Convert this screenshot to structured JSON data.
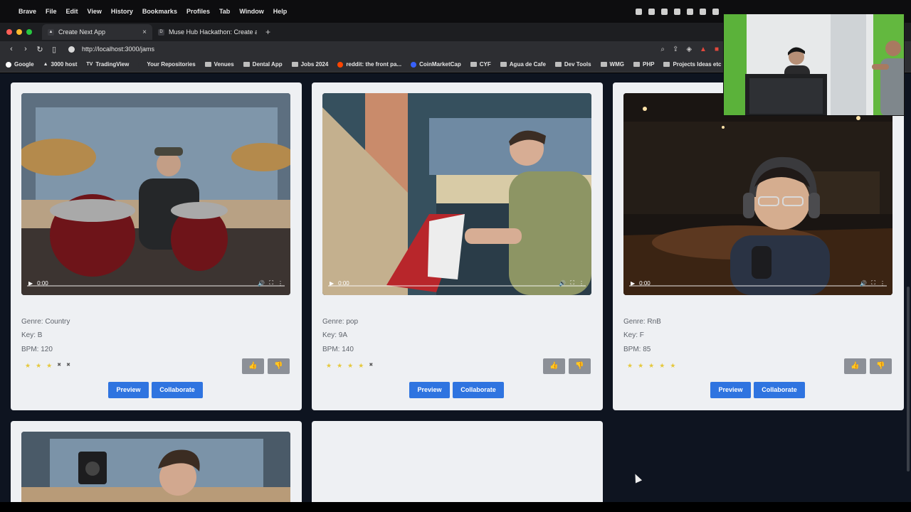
{
  "menubar": {
    "app": "Brave",
    "items": [
      "File",
      "Edit",
      "View",
      "History",
      "Bookmarks",
      "Profiles",
      "Tab",
      "Window",
      "Help"
    ]
  },
  "tabs": [
    {
      "title": "Create Next App",
      "favicon": "triangle-icon",
      "active": true
    },
    {
      "title": "Muse Hub Hackathon: Create an",
      "favicon": "D",
      "active": false
    }
  ],
  "url": "http://localhost:3000/jams",
  "bookmarks": [
    {
      "label": "Google",
      "icon": "google-icon"
    },
    {
      "label": "3000 host",
      "icon": "triangle-icon"
    },
    {
      "label": "TradingView",
      "icon": "tv-icon"
    },
    {
      "label": "Your Repositories",
      "icon": "github-icon"
    },
    {
      "label": "Venues",
      "icon": "folder-icon"
    },
    {
      "label": "Dental App",
      "icon": "folder-icon"
    },
    {
      "label": "Jobs 2024",
      "icon": "folder-icon"
    },
    {
      "label": "reddit: the front pa...",
      "icon": "reddit-icon"
    },
    {
      "label": "CoinMarketCap",
      "icon": "coin-icon"
    },
    {
      "label": "CYF",
      "icon": "folder-icon"
    },
    {
      "label": "Agua de Cafe",
      "icon": "folder-icon"
    },
    {
      "label": "Dev Tools",
      "icon": "folder-icon"
    },
    {
      "label": "WMG",
      "icon": "folder-icon"
    },
    {
      "label": "PHP",
      "icon": "folder-icon"
    },
    {
      "label": "Projects Ideas etc",
      "icon": "folder-icon"
    }
  ],
  "cards": [
    {
      "genre": "Genre: Country",
      "key": "Key: B",
      "bpm": "BPM: 120",
      "rating": 3,
      "time": "0:00",
      "scene": "drums"
    },
    {
      "genre": "Genre: pop",
      "key": "Key: 9A",
      "bpm": "BPM: 140",
      "rating": 4,
      "time": "0:00",
      "scene": "keys"
    },
    {
      "genre": "Genre: RnB",
      "key": "Key: F",
      "bpm": "BPM: 85",
      "rating": 5,
      "time": "0:00",
      "scene": "vocal"
    }
  ],
  "buttons": {
    "preview": "Preview",
    "collaborate": "Collaborate",
    "upvote": "👍",
    "downvote": "👎"
  },
  "colors": {
    "accent": "#2f74e0",
    "page_bg": "#0e1420",
    "card_bg": "#eef0f3",
    "star": "#e5c83d"
  }
}
